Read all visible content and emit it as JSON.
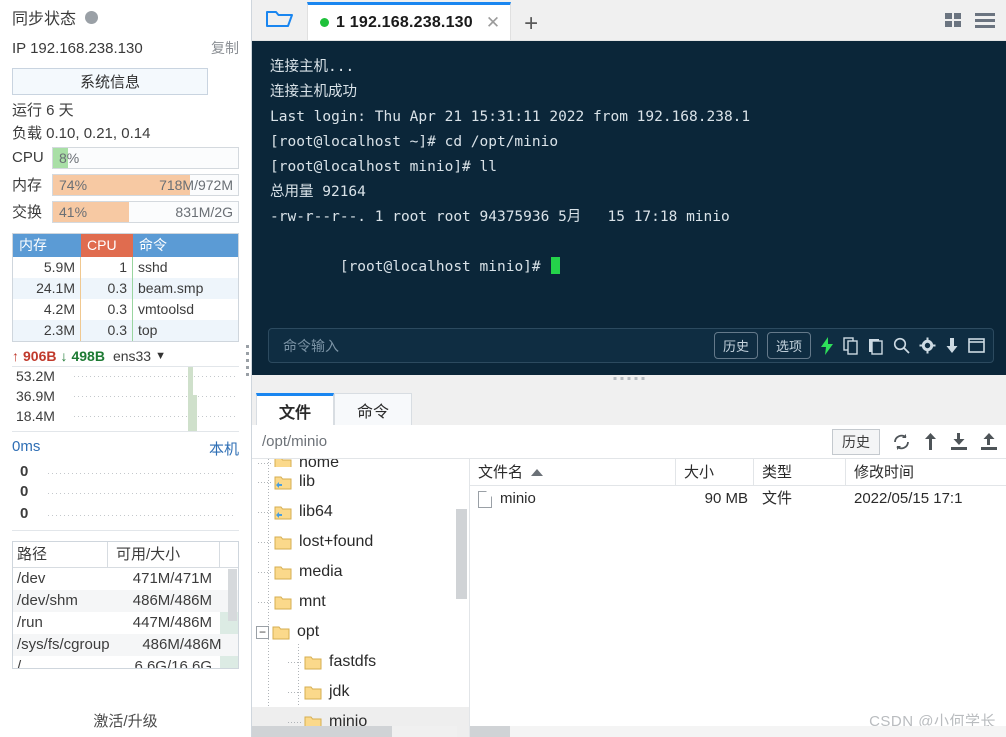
{
  "sidebar": {
    "sync_title": "同步状态",
    "sync_status_color": "#9aa0a6",
    "ip_label": "IP 192.168.238.130",
    "copy_label": "复制",
    "system_info_button": "系统信息",
    "uptime": "运行 6 天",
    "loadavg": "负载 0.10, 0.21, 0.14",
    "gauges": [
      {
        "label": "CPU",
        "percent": "8%",
        "fill": 8,
        "amount": "",
        "color": "#a9dfa6"
      },
      {
        "label": "内存",
        "percent": "74%",
        "fill": 74,
        "amount": "718M/972M",
        "color": "#f7c9a3"
      },
      {
        "label": "交换",
        "percent": "41%",
        "fill": 41,
        "amount": "831M/2G",
        "color": "#f7c9a3"
      }
    ],
    "process_table": {
      "headers": {
        "mem": "内存",
        "cpu": "CPU",
        "cmd": "命令"
      },
      "header_mem_color": "#5b9bd5",
      "header_cpu_color": "#e06c4f",
      "rows": [
        {
          "mem": "5.9M",
          "cpu": "1",
          "cmd": "sshd"
        },
        {
          "mem": "24.1M",
          "cpu": "0.3",
          "cmd": "beam.smp"
        },
        {
          "mem": "4.2M",
          "cpu": "0.3",
          "cmd": "vmtoolsd"
        },
        {
          "mem": "2.3M",
          "cpu": "0.3",
          "cmd": "top"
        }
      ]
    },
    "network": {
      "up": "906B",
      "down": "498B",
      "interface": "ens33",
      "up_arrow": "↑",
      "down_arrow": "↓",
      "y_labels": [
        "53.2M",
        "36.9M",
        "18.4M"
      ]
    },
    "ping": {
      "latency": "0ms",
      "target": "本机",
      "y_labels": [
        "0",
        "0",
        "0"
      ]
    },
    "disk_table": {
      "headers": {
        "path": "路径",
        "size": "可用/大小"
      },
      "rows": [
        {
          "path": "/dev",
          "size": "471M/471M",
          "used": 0
        },
        {
          "path": "/dev/shm",
          "size": "486M/486M",
          "used": 0
        },
        {
          "path": "/run",
          "size": "447M/486M",
          "used": 8
        },
        {
          "path": "/sys/fs/cgroup",
          "size": "486M/486M",
          "used": 0
        },
        {
          "path": "/",
          "size": "6.6G/16.6G",
          "used": 60
        }
      ]
    },
    "activate_label": "激活/升级"
  },
  "tabbar": {
    "folder_icon": "open-folder-icon",
    "tabs": [
      {
        "label": "1 192.168.238.130",
        "status_color": "#1fc13b",
        "close": "✕",
        "active": true
      }
    ],
    "add_label": "✛",
    "grid_icon": "grid-view-icon",
    "menu_icon": "hamburger-menu-icon"
  },
  "terminal": {
    "background": "#0b2639",
    "lines": [
      "连接主机...",
      "连接主机成功",
      "Last login: Thu Apr 21 15:31:11 2022 from 192.168.238.1",
      "[root@localhost ~]# cd /opt/minio",
      "[root@localhost minio]# ll",
      "总用量 92164",
      "-rw-r--r--. 1 root root 94375936 5月   15 17:18 minio",
      "[root@localhost minio]# "
    ],
    "cursor_color": "#24d34a",
    "command_input": {
      "placeholder": "命令输入",
      "value": "",
      "history_button": "历史",
      "options_button": "选项",
      "icons": [
        "bolt-icon",
        "copy-icon",
        "paste-icon",
        "search-icon",
        "gear-icon",
        "download-icon",
        "window-icon"
      ]
    }
  },
  "file_panel": {
    "tabs": [
      {
        "label": "文件",
        "active": true
      },
      {
        "label": "命令",
        "active": false
      }
    ],
    "path": "/opt/minio",
    "history_button": "历史",
    "toolbar_icons": [
      "refresh-icon",
      "parent-dir-icon",
      "download-icon",
      "upload-icon"
    ],
    "tree": [
      {
        "label": "home",
        "depth": 1,
        "expander": "",
        "partial": true,
        "selected": false
      },
      {
        "label": "lib",
        "depth": 1,
        "expander": "",
        "selected": false,
        "link": true
      },
      {
        "label": "lib64",
        "depth": 1,
        "expander": "",
        "selected": false,
        "link": true
      },
      {
        "label": "lost+found",
        "depth": 1,
        "expander": "",
        "selected": false
      },
      {
        "label": "media",
        "depth": 1,
        "expander": "",
        "selected": false
      },
      {
        "label": "mnt",
        "depth": 1,
        "expander": "",
        "selected": false
      },
      {
        "label": "opt",
        "depth": 1,
        "expander": "−",
        "selected": false
      },
      {
        "label": "fastdfs",
        "depth": 2,
        "expander": "",
        "selected": false
      },
      {
        "label": "jdk",
        "depth": 2,
        "expander": "",
        "selected": false
      },
      {
        "label": "minio",
        "depth": 2,
        "expander": "",
        "selected": true
      }
    ],
    "list": {
      "headers": {
        "name": "文件名",
        "size": "大小",
        "type": "类型",
        "time": "修改时间"
      },
      "sort_column": "文件名",
      "sort_dir": "asc",
      "rows": [
        {
          "name": "minio",
          "size": "90 MB",
          "type": "文件",
          "time": "2022/05/15 17:1"
        }
      ]
    }
  },
  "watermark": "CSDN @小何学长"
}
